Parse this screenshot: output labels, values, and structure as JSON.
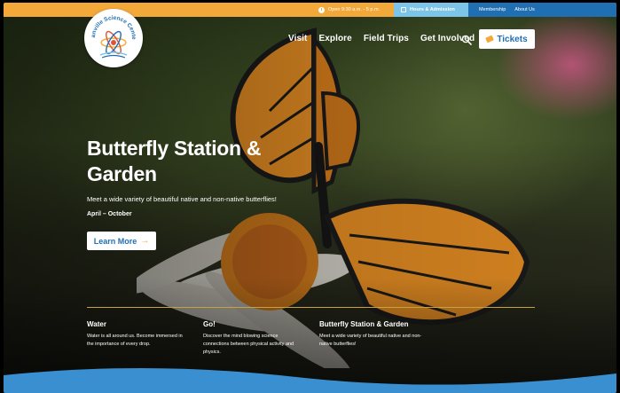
{
  "topbar": {
    "hours": "Open 9:30 a.m. - 5 p.m.",
    "hours_admission": "Hours & Admission",
    "membership": "Membership",
    "about": "About Us"
  },
  "logo": {
    "text": "Danville Science Center"
  },
  "nav": {
    "items": [
      "Visit",
      "Explore",
      "Field Trips",
      "Get Involved"
    ],
    "tickets_label": "Tickets"
  },
  "hero": {
    "title": "Butterfly Station & Garden",
    "subtitle": "Meet a wide variety of beautiful native and non-native butterflies!",
    "dates": "April – October",
    "cta_label": "Learn More"
  },
  "features": [
    {
      "title": "Water",
      "text": "Water is all around us. Become immersed in the importance of every drop."
    },
    {
      "title": "Go!",
      "text": "Discover the mind blowing science connections between physical activity and physics."
    },
    {
      "title": "Butterfly Station & Garden",
      "text": "Meet a wide variety of beautiful native and non-native butterflies!"
    }
  ],
  "colors": {
    "topbar_orange": "#f3a93a",
    "topbar_light_blue": "#7cc4e8",
    "topbar_blue": "#1f6fb2",
    "accent_gold": "#c9a23d"
  }
}
